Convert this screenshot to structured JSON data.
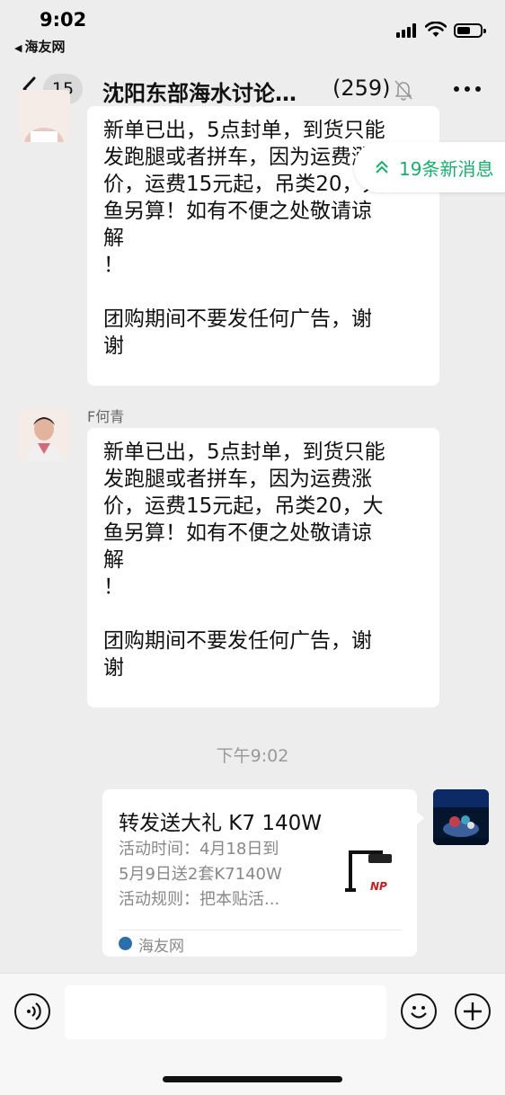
{
  "status_bar": {
    "time": "9:02",
    "back_app": "海友网"
  },
  "nav": {
    "unread_count": "15",
    "title": "沈阳东部海水讨论…",
    "member_count": "(259)"
  },
  "new_messages_pill": "19条新消息",
  "messages": [
    {
      "sender": "",
      "lines": [
        "新单已出，5点封单，到货只能",
        "发跑腿或者拼车，因为运费涨",
        "价，运费15元起，吊类20，大",
        "鱼另算！如有不便之处敬请谅",
        "解",
        "！",
        "",
        "团购期间不要发任何广告，谢",
        "谢"
      ]
    },
    {
      "sender": "F何青",
      "lines": [
        "新单已出，5点封单，到货只能",
        "发跑腿或者拼车，因为运费涨",
        "价，运费15元起，吊类20，大",
        "鱼另算！如有不便之处敬请谅",
        "解",
        "！",
        "",
        "团购期间不要发任何广告，谢",
        "谢"
      ]
    }
  ],
  "timestamp": "下午9:02",
  "link_card": {
    "title": "转发送大礼 K7 140W",
    "desc_lines": [
      "活动时间：4月18日到",
      "5月9日送2套K7140W",
      "活动规则：把本贴活..."
    ],
    "source": "海友网"
  },
  "input": {
    "placeholder": ""
  },
  "colors": {
    "accent_green": "#1aad6d",
    "background": "#ededed",
    "bubble": "#ffffff"
  }
}
